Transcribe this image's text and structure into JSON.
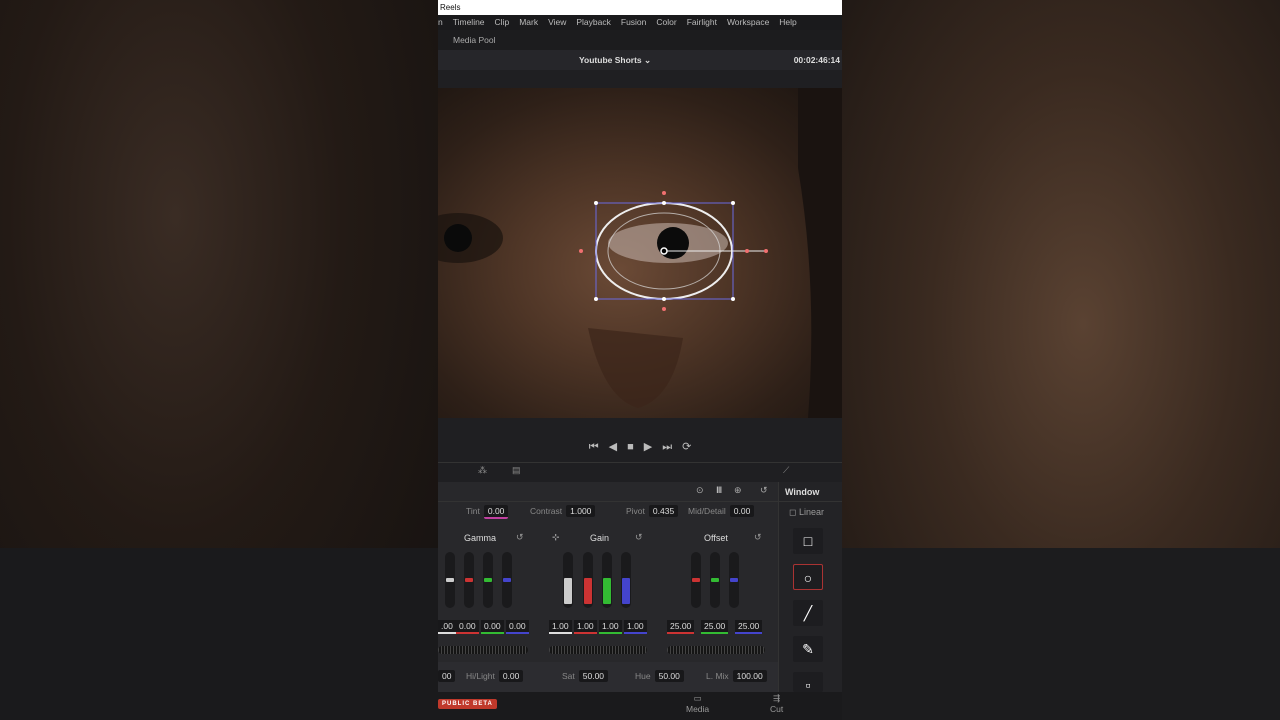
{
  "title": "Reels",
  "menu": [
    "n",
    "Timeline",
    "Clip",
    "Mark",
    "View",
    "Playback",
    "Fusion",
    "Color",
    "Fairlight",
    "Workspace",
    "Help"
  ],
  "media_pool": "Media Pool",
  "timeline_name": "Youtube Shorts",
  "timecode": "00:02:46:14",
  "primaries": {
    "tint_label": "Tint",
    "tint": "0.00",
    "contrast_label": "Contrast",
    "contrast": "1.000",
    "pivot_label": "Pivot",
    "pivot": "0.435",
    "mid_label": "Mid/Detail",
    "mid": "0.00",
    "gamma_label": "Gamma",
    "gain_label": "Gain",
    "offset_label": "Offset",
    "gamma_values": [
      ".00",
      "0.00",
      "0.00",
      "0.00"
    ],
    "gain_values": [
      "1.00",
      "1.00",
      "1.00",
      "1.00"
    ],
    "offset_values": [
      "25.00",
      "25.00",
      "25.00"
    ],
    "lum_value": "00",
    "hilight_label": "Hi/Light",
    "hilight": "0.00",
    "sat_label": "Sat",
    "sat": "50.00",
    "hue_label": "Hue",
    "hue": "50.00",
    "lmix_label": "L. Mix",
    "lmix": "100.00"
  },
  "window_panel": {
    "title": "Window",
    "linear": "Linear"
  },
  "bottom": {
    "badge": "PUBLIC BETA",
    "media": "Media",
    "cut": "Cut"
  }
}
